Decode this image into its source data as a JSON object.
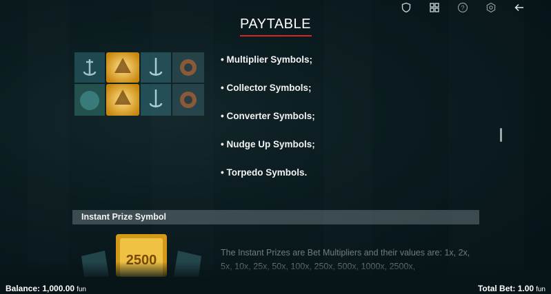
{
  "header": {
    "title": "PAYTABLE",
    "icons": [
      "shield-icon",
      "grid-icon",
      "help-icon",
      "settings-icon",
      "back-arrow-icon"
    ]
  },
  "features": {
    "items": [
      "• Multiplier Symbols;",
      "• Collector Symbols;",
      "• Converter Symbols;",
      "• Nudge Up Symbols;",
      "• Torpedo Symbols."
    ]
  },
  "instant_prize": {
    "title": "Instant Prize Symbol",
    "badge_value": "2500",
    "description": "The Instant Prizes are Bet Multipliers and their values are: 1x, 2x, 5x, 10x, 25x, 50x, 100x, 250x, 500x, 1000x, 2500x,"
  },
  "footer": {
    "balance_label": "Balance: 1,000.00",
    "balance_unit": "fun",
    "total_bet_label": "Total Bet: 1.00",
    "total_bet_unit": "fun"
  },
  "colors": {
    "accent_red": "#d42727",
    "gold": "#e3a81c",
    "background": "#0f2528"
  }
}
